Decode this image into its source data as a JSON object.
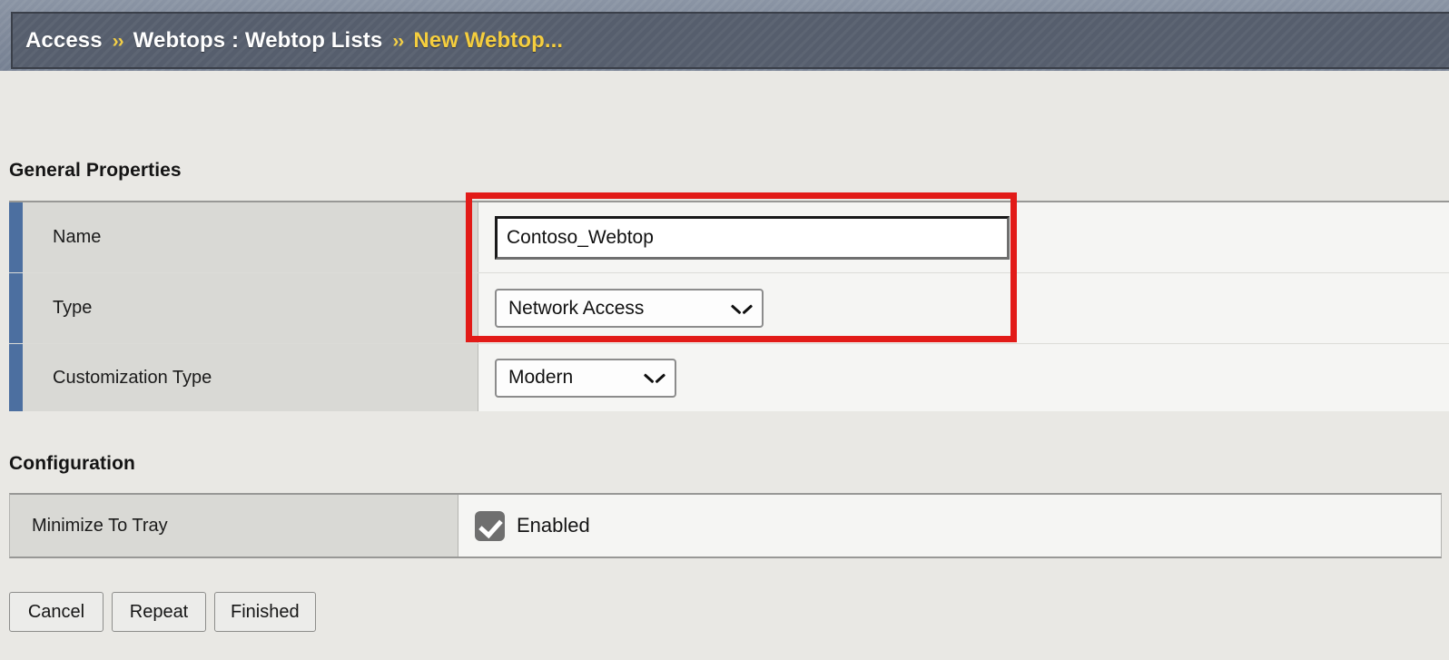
{
  "header": {
    "crumbs": [
      {
        "label": "Access",
        "current": false
      },
      {
        "label": "Webtops : Webtop Lists",
        "current": false
      },
      {
        "label": "New Webtop...",
        "current": true
      }
    ],
    "separator": "››"
  },
  "sections": {
    "general": {
      "title": "General Properties",
      "rows": [
        {
          "label": "Name",
          "control": "text-input",
          "value": "Contoso_Webtop"
        },
        {
          "label": "Type",
          "control": "select",
          "value": "Network Access"
        },
        {
          "label": "Customization Type",
          "control": "select",
          "value": "Modern"
        }
      ]
    },
    "configuration": {
      "title": "Configuration",
      "rows": [
        {
          "label": "Minimize To Tray",
          "control": "checkbox",
          "value": "Enabled",
          "checked": true
        }
      ]
    }
  },
  "buttons": [
    {
      "label": "Cancel"
    },
    {
      "label": "Repeat"
    },
    {
      "label": "Finished"
    }
  ],
  "annotation": {
    "color": "#e21b18",
    "highlights": [
      "Name",
      "Type"
    ]
  },
  "colors": {
    "page_background": "#e9e8e4",
    "header_bar": "#565e6d",
    "header_surround": "#7d8798",
    "crumb_current": "#f5ce3e",
    "row_accent": "#4c6fa0",
    "label_cell": "#d9d9d5",
    "value_cell": "#f5f5f3",
    "checkbox_fill": "#6f6f6f",
    "annotation": "#e21b18"
  }
}
